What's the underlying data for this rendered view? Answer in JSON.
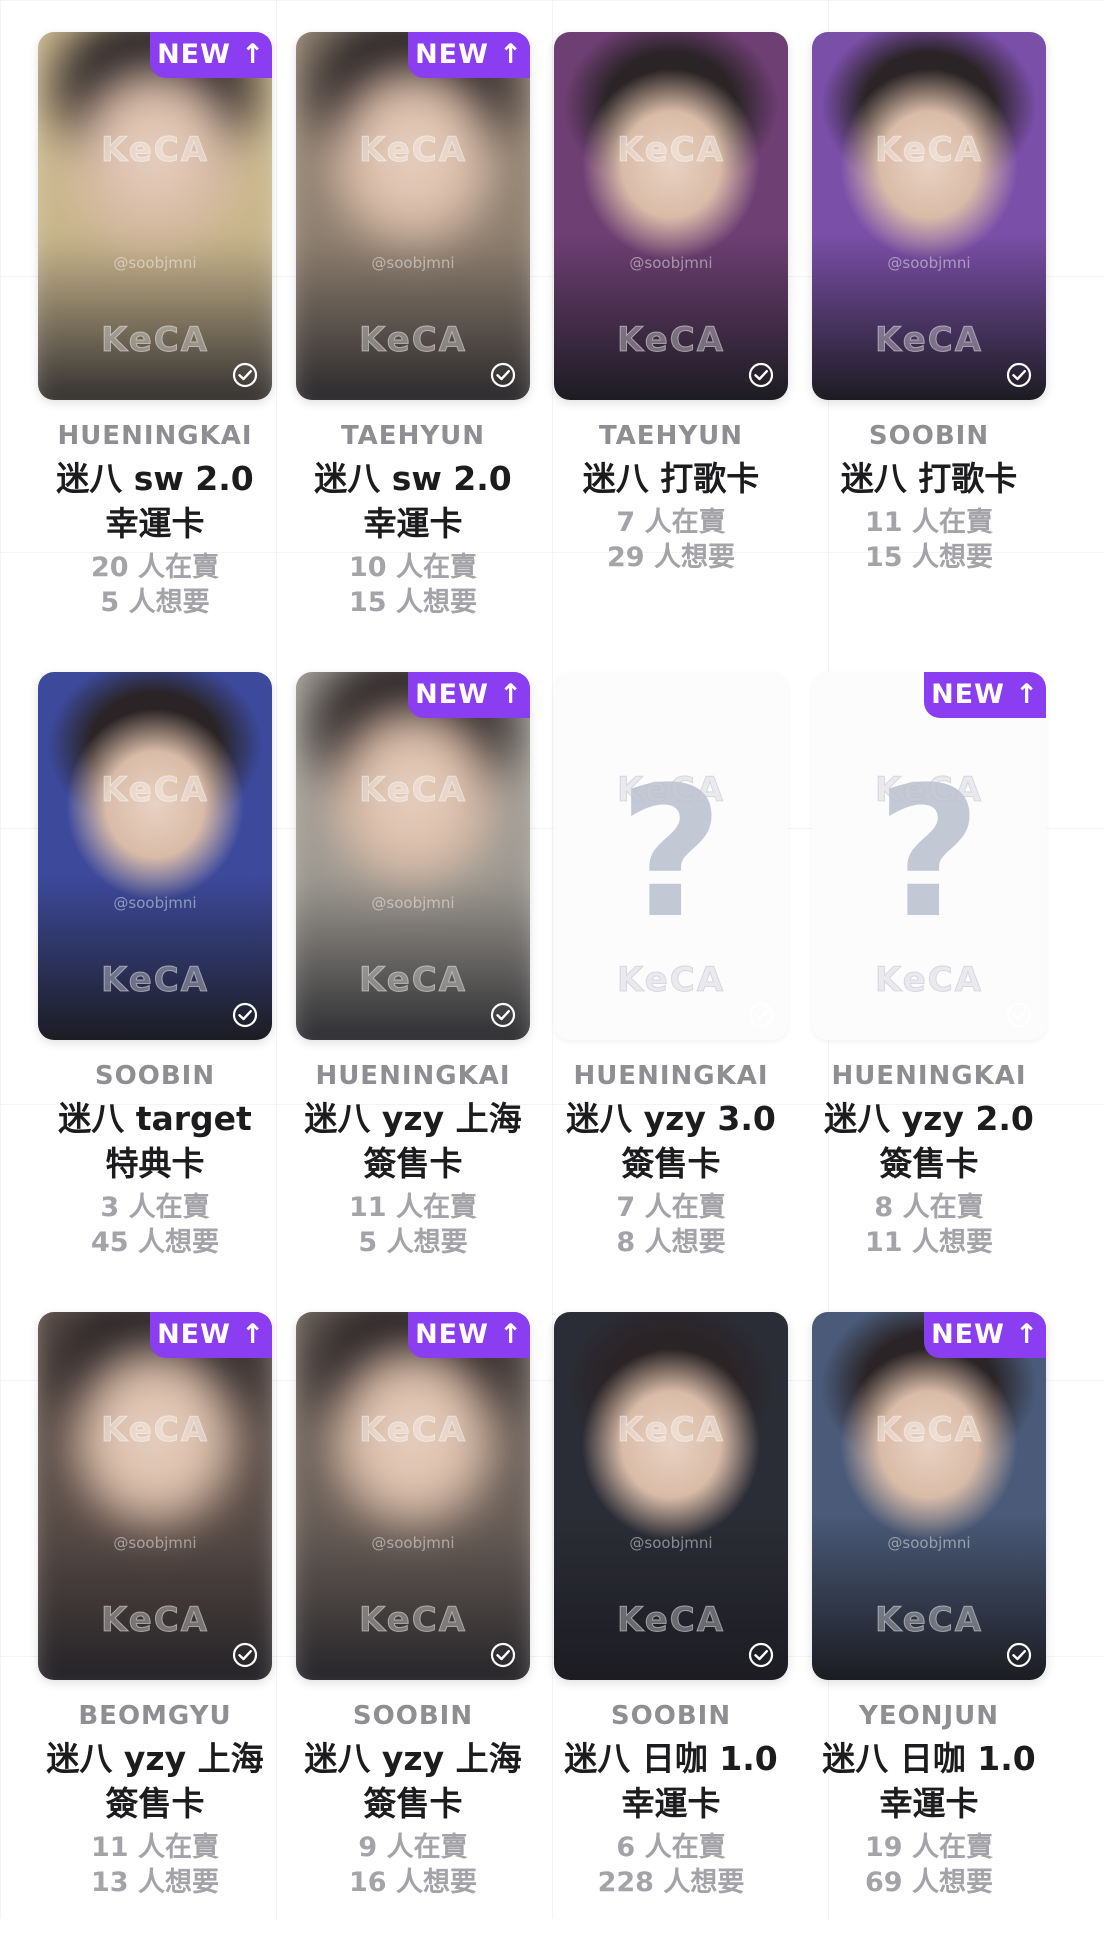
{
  "badge_label": "NEW ↑",
  "watermark_text": "KeCA",
  "handle_text": "@soobjmni",
  "unknown_mark": "?",
  "accent_color": "#8b3df2",
  "cards": [
    {
      "member": "HUENINGKAI",
      "title1": "迷八 sw 2.0",
      "title2": "幸運卡",
      "selling": "20 人在賣",
      "wanting": "5 人想要",
      "is_new": true,
      "photo": "blurred",
      "tone": "#c9b68c"
    },
    {
      "member": "TAEHYUN",
      "title1": "迷八 sw 2.0",
      "title2": "幸運卡",
      "selling": "10 人在賣",
      "wanting": "15 人想要",
      "is_new": true,
      "photo": "blurred",
      "tone": "#8f8070"
    },
    {
      "member": "TAEHYUN",
      "title1": "迷八 打歌卡",
      "title2": "",
      "selling": "7 人在賣",
      "wanting": "29 人想要",
      "is_new": false,
      "photo": "clear",
      "tone": "#6e3f73"
    },
    {
      "member": "SOOBIN",
      "title1": "迷八 打歌卡",
      "title2": "",
      "selling": "11 人在賣",
      "wanting": "15 人想要",
      "is_new": false,
      "photo": "clear",
      "tone": "#7a4fa8"
    },
    {
      "member": "SOOBIN",
      "title1": "迷八 target",
      "title2": "特典卡",
      "selling": "3 人在賣",
      "wanting": "45 人想要",
      "is_new": false,
      "photo": "clear",
      "tone": "#3d4a9c"
    },
    {
      "member": "HUENINGKAI",
      "title1": "迷八 yzy 上海",
      "title2": "簽售卡",
      "selling": "11 人在賣",
      "wanting": "5 人想要",
      "is_new": true,
      "photo": "blurred",
      "tone": "#9e9a92"
    },
    {
      "member": "HUENINGKAI",
      "title1": "迷八 yzy 3.0",
      "title2": "簽售卡",
      "selling": "7 人在賣",
      "wanting": "8 人想要",
      "is_new": false,
      "photo": "unknown",
      "tone": "#fcfcfd"
    },
    {
      "member": "HUENINGKAI",
      "title1": "迷八 yzy 2.0",
      "title2": "簽售卡",
      "selling": "8 人在賣",
      "wanting": "11 人想要",
      "is_new": true,
      "photo": "unknown",
      "tone": "#fcfcfd"
    },
    {
      "member": "BEOMGYU",
      "title1": "迷八 yzy 上海",
      "title2": "簽售卡",
      "selling": "11 人在賣",
      "wanting": "13 人想要",
      "is_new": true,
      "photo": "blurred",
      "tone": "#5a4d47"
    },
    {
      "member": "SOOBIN",
      "title1": "迷八 yzy 上海",
      "title2": "簽售卡",
      "selling": "9 人在賣",
      "wanting": "16 人想要",
      "is_new": true,
      "photo": "blurred",
      "tone": "#6a5f58"
    },
    {
      "member": "SOOBIN",
      "title1": "迷八 日咖 1.0",
      "title2": "幸運卡",
      "selling": "6 人在賣",
      "wanting": "228 人想要",
      "is_new": false,
      "photo": "clear",
      "tone": "#2b2d36"
    },
    {
      "member": "YEONJUN",
      "title1": "迷八 日咖 1.0",
      "title2": "幸運卡",
      "selling": "19 人在賣",
      "wanting": "69 人想要",
      "is_new": true,
      "photo": "clear",
      "tone": "#4a5a78"
    }
  ]
}
